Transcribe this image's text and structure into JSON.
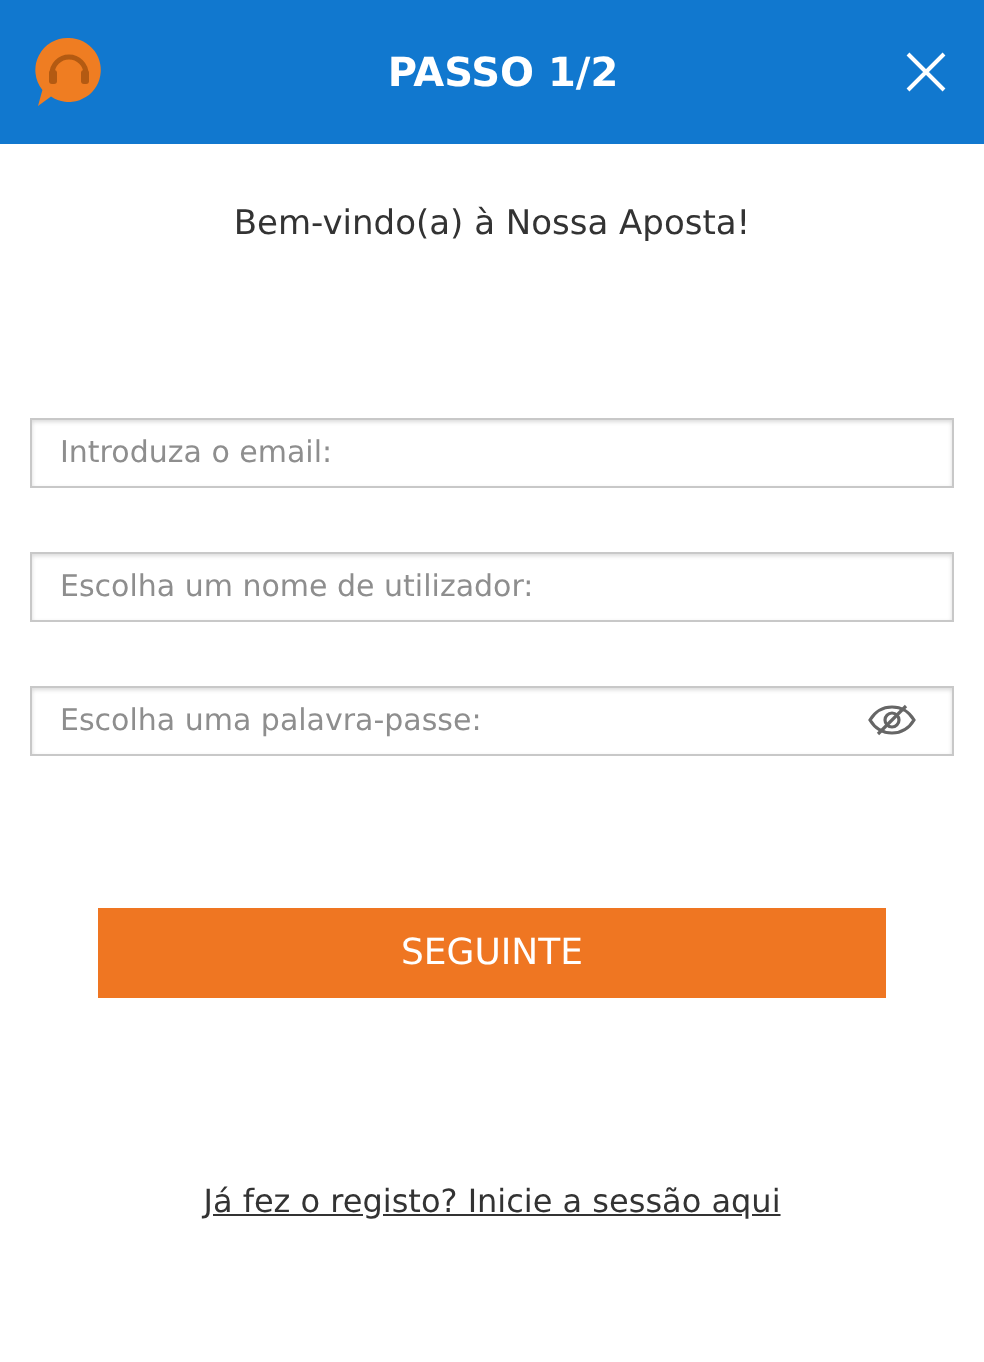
{
  "header": {
    "title": "PASSO 1/2"
  },
  "welcome": "Bem-vindo(a) à Nossa Aposta!",
  "fields": [
    {
      "kind": "text",
      "placeholder": "Introduza o email:"
    },
    {
      "kind": "text",
      "placeholder": "Escolha um nome de utilizador:"
    },
    {
      "kind": "password",
      "placeholder": "Escolha uma palavra-passe:"
    }
  ],
  "next_button": "SEGUINTE",
  "login_link": "Já fez o registo? Inicie a sessão aqui"
}
